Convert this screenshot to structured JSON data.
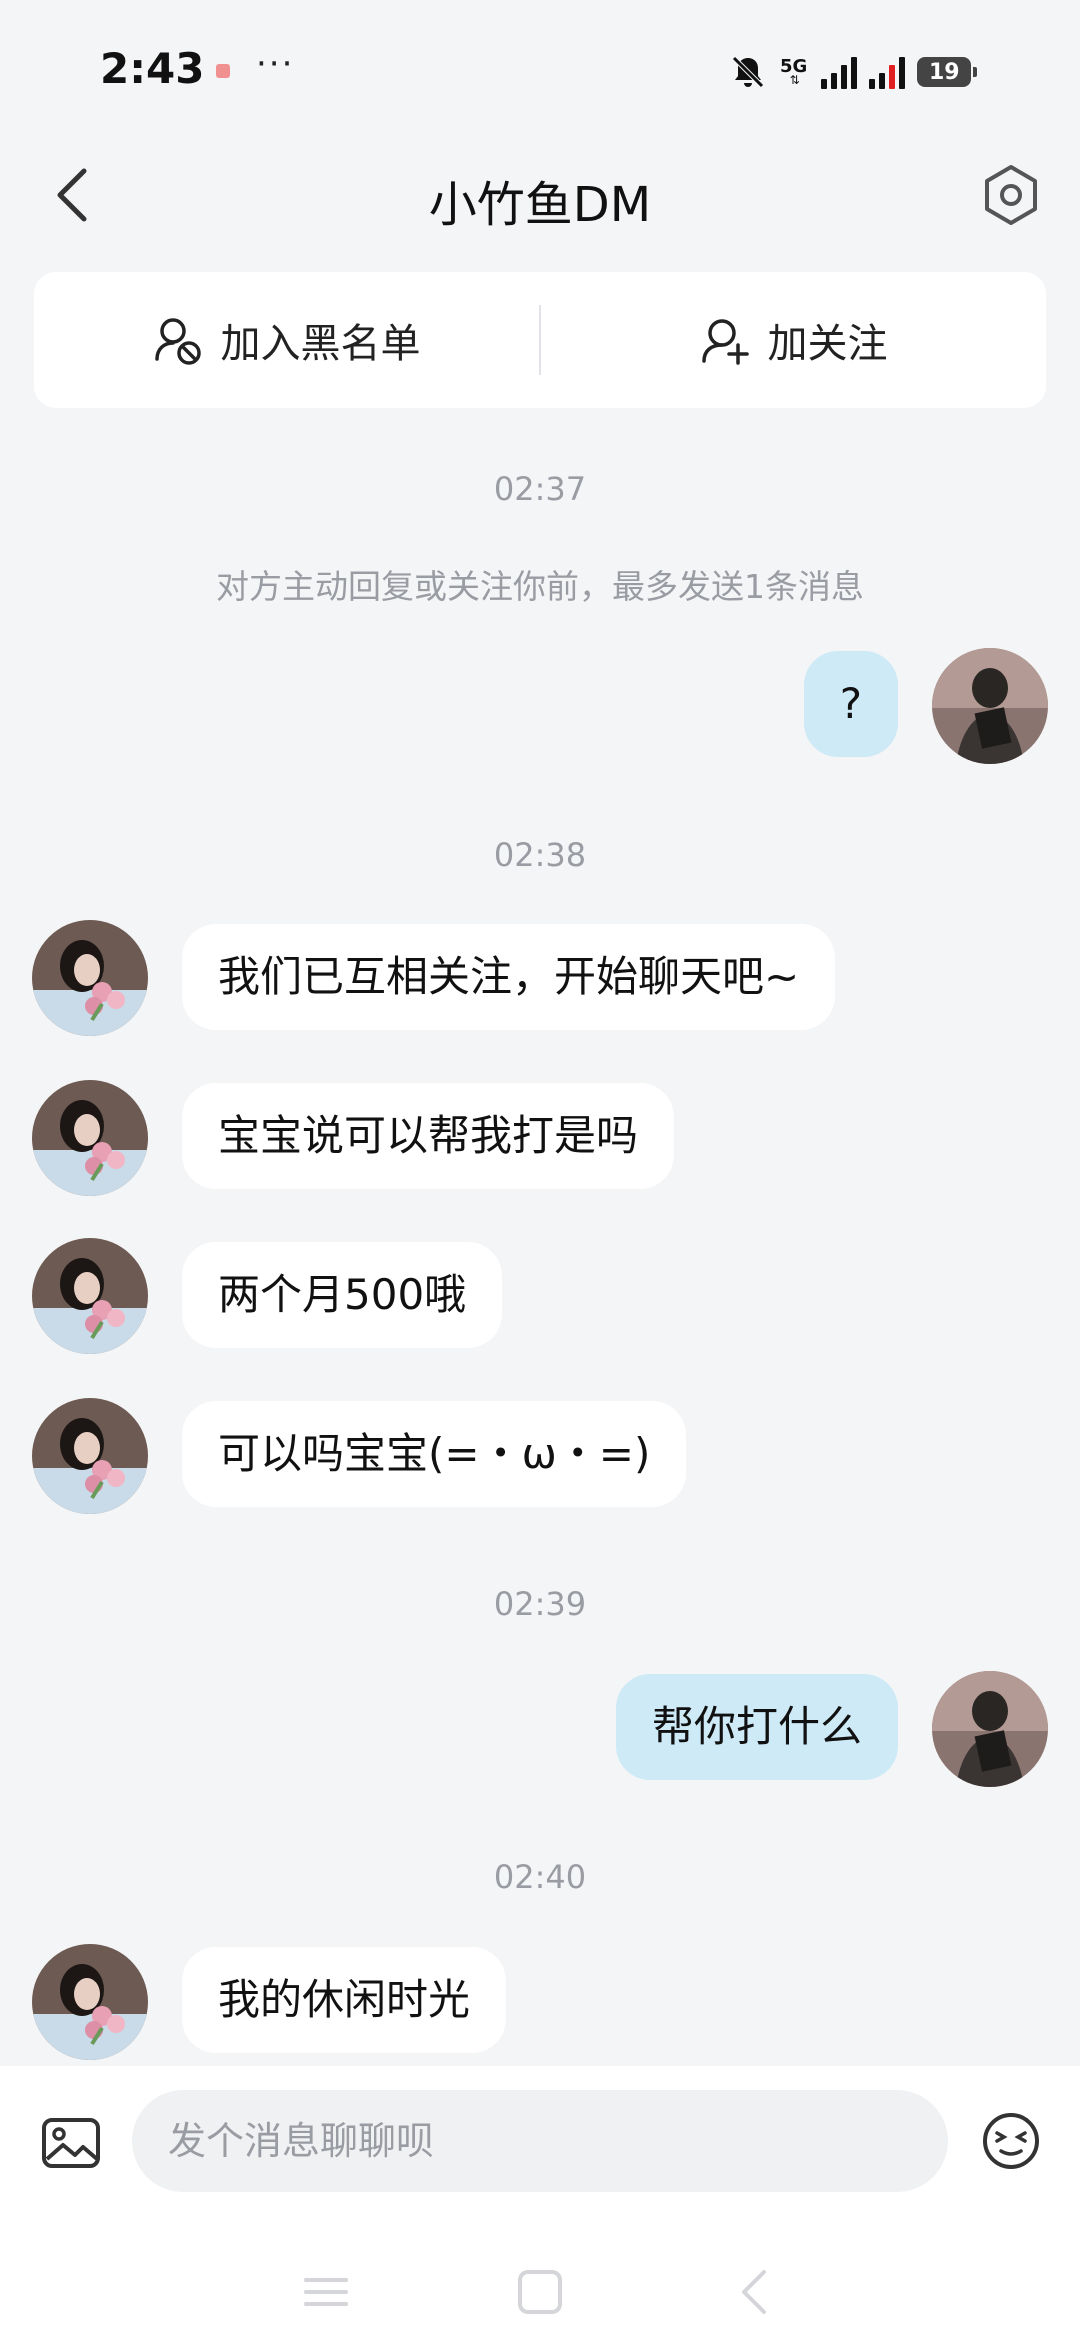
{
  "status_bar": {
    "time": "2:43",
    "overflow": "···",
    "network": "5G",
    "battery": "19"
  },
  "header": {
    "title": "小竹鱼DM"
  },
  "actions": {
    "blacklist_label": "加入黑名单",
    "follow_label": "加关注"
  },
  "chat": {
    "ts1": "02:37",
    "system_note": "对方主动回复或关注你前，最多发送1条消息",
    "msg_out_1": "?",
    "ts2": "02:38",
    "msg_in_1": "我们已互相关注，开始聊天吧~",
    "msg_in_2": "宝宝说可以帮我打是吗",
    "msg_in_3": "两个月500哦",
    "msg_in_4": "可以吗宝宝(=・ω・=)",
    "ts3": "02:39",
    "msg_out_2": "帮你打什么",
    "ts4": "02:40",
    "msg_in_5": "我的休闲时光"
  },
  "input": {
    "placeholder": "发个消息聊聊呗"
  },
  "icons": {
    "back": "chevron-left-icon",
    "settings": "settings-icon",
    "blacklist": "user-block-icon",
    "follow": "user-add-icon",
    "image": "image-icon",
    "emoji": "emoji-icon"
  },
  "colors": {
    "background": "#f4f5f7",
    "bubble_out": "#cdeaf6",
    "bubble_in": "#ffffff",
    "muted_text": "#9a9ca3"
  }
}
